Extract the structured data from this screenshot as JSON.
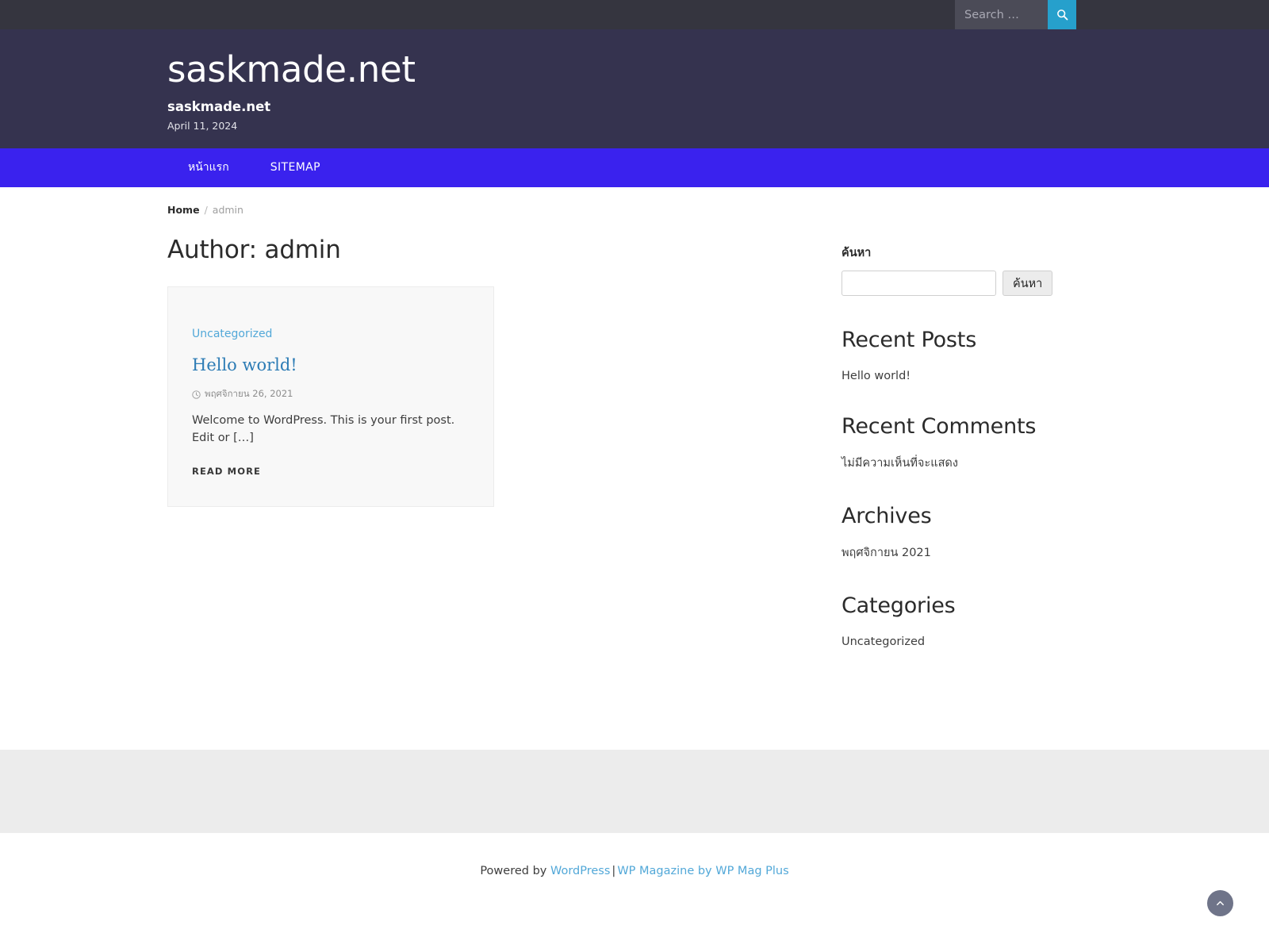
{
  "topbar": {
    "search_placeholder": "Search …",
    "search_value": "",
    "search_icon": "search-icon"
  },
  "header": {
    "title": "saskmade.net",
    "tagline": "saskmade.net",
    "date": "April 11, 2024",
    "background_color": "#35334f"
  },
  "nav": {
    "background_color": "#3a22ee",
    "items": [
      {
        "label": "หน้าแรก"
      },
      {
        "label": "SITEMAP"
      }
    ]
  },
  "breadcrumb": {
    "home_label": "Home",
    "separator": "/",
    "current_label": "admin"
  },
  "main": {
    "archive_title": "Author: admin",
    "post": {
      "category": "Uncategorized",
      "title": "Hello world!",
      "date": "พฤศจิกายน 26, 2021",
      "date_icon": "clock-icon",
      "excerpt": "Welcome to WordPress. This is your first post. Edit or […]",
      "read_more": "READ MORE"
    }
  },
  "sidebar": {
    "search": {
      "label": "ค้นหา",
      "input_value": "",
      "button_label": "ค้นหา"
    },
    "recent_posts": {
      "title": "Recent Posts",
      "items": [
        {
          "label": "Hello world!"
        }
      ]
    },
    "recent_comments": {
      "title": "Recent Comments",
      "empty_text": "ไม่มีความเห็นที่จะแสดง"
    },
    "archives": {
      "title": "Archives",
      "items": [
        {
          "label": "พฤศจิกายน 2021"
        }
      ]
    },
    "categories": {
      "title": "Categories",
      "items": [
        {
          "label": "Uncategorized"
        }
      ]
    }
  },
  "footer": {
    "powered_by": "Powered by",
    "wordpress_link": "WordPress",
    "pipe": "|",
    "theme_link": "WP Magazine by WP Mag Plus"
  },
  "scroll_top": {
    "icon": "chevron-up-icon",
    "color": "#6f7489"
  }
}
